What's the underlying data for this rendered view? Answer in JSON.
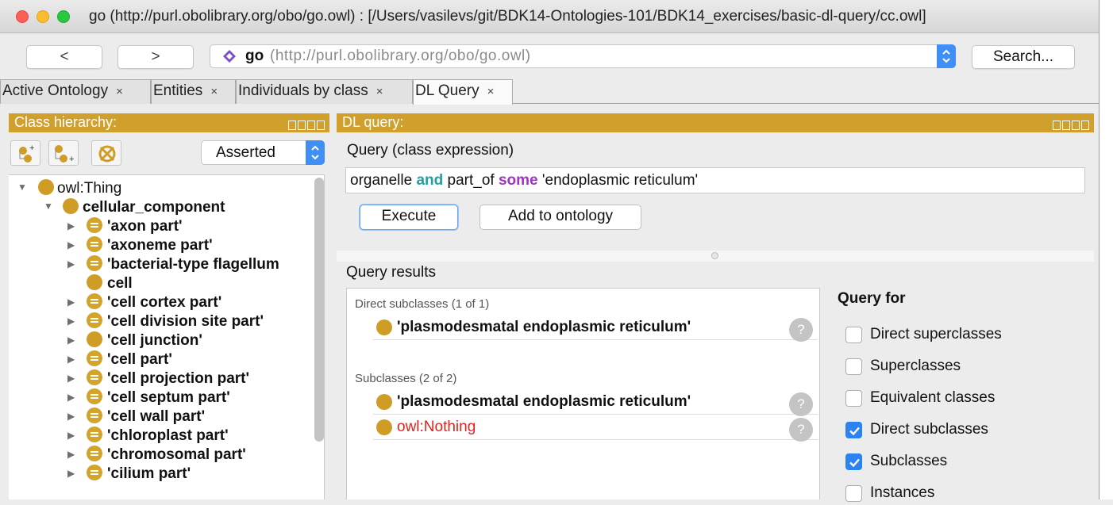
{
  "window": {
    "title": "go (http://purl.obolibrary.org/obo/go.owl)  : [/Users/vasilevs/git/BDK14-Ontologies-101/BDK14_exercises/basic-dl-query/cc.owl]"
  },
  "navbar": {
    "back_label": "<",
    "forward_label": ">",
    "ontology_name": "go",
    "ontology_iri": "(http://purl.obolibrary.org/obo/go.owl)",
    "search_label": "Search..."
  },
  "tabs": [
    {
      "label": "Active Ontology",
      "close": "×"
    },
    {
      "label": "Entities",
      "close": "×"
    },
    {
      "label": "Individuals by class",
      "close": "×"
    },
    {
      "label": "DL Query",
      "close": "×",
      "active": true
    }
  ],
  "class_hierarchy": {
    "title": "Class hierarchy:",
    "mode": "Asserted",
    "items": [
      {
        "label": "owl:Thing",
        "bold": false,
        "expanded": true
      },
      {
        "label": "cellular_component",
        "bold": true,
        "expanded": true
      },
      {
        "label": "'axon part'",
        "bold": true
      },
      {
        "label": "'axoneme part'",
        "bold": true
      },
      {
        "label": "'bacterial-type flagellum",
        "bold": true
      },
      {
        "label": "cell",
        "bold": true
      },
      {
        "label": "'cell cortex part'",
        "bold": true
      },
      {
        "label": "'cell division site part'",
        "bold": true
      },
      {
        "label": "'cell junction'",
        "bold": true
      },
      {
        "label": "'cell part'",
        "bold": true
      },
      {
        "label": "'cell projection part'",
        "bold": true
      },
      {
        "label": "'cell septum part'",
        "bold": true
      },
      {
        "label": "'cell wall part'",
        "bold": true
      },
      {
        "label": "'chloroplast part'",
        "bold": true
      },
      {
        "label": "'chromosomal part'",
        "bold": true
      },
      {
        "label": "'cilium part'",
        "bold": true
      }
    ]
  },
  "dl_query": {
    "title": "DL query:",
    "query_label": "Query (class expression)",
    "query_parts": {
      "p1": "organelle ",
      "kw1": "and",
      "p2": " part_of ",
      "kw2": "some",
      "p3": " 'endoplasmic reticulum'"
    },
    "execute_label": "Execute",
    "add_label": "Add to ontology",
    "results_label": "Query results",
    "direct_subclasses_header": "Direct subclasses (1 of 1)",
    "direct_subclasses": [
      "'plasmodesmatal endoplasmic reticulum'"
    ],
    "subclasses_header": "Subclasses (2 of 2)",
    "subclasses": [
      "'plasmodesmatal endoplasmic reticulum'",
      "owl:Nothing"
    ],
    "help_glyph": "?",
    "query_for_label": "Query for",
    "query_for": [
      {
        "label": "Direct superclasses",
        "checked": false
      },
      {
        "label": "Superclasses",
        "checked": false
      },
      {
        "label": "Equivalent classes",
        "checked": false
      },
      {
        "label": "Direct subclasses",
        "checked": true
      },
      {
        "label": "Subclasses",
        "checked": true
      },
      {
        "label": "Instances",
        "checked": false
      }
    ]
  },
  "colors": {
    "panel_header": "#d19f2b",
    "class_icon": "#cf9d26",
    "keyword_and": "#22a0a0",
    "keyword_some": "#a033c0",
    "nothing_red": "#e0231c",
    "checkbox_blue": "#2c83f0"
  }
}
